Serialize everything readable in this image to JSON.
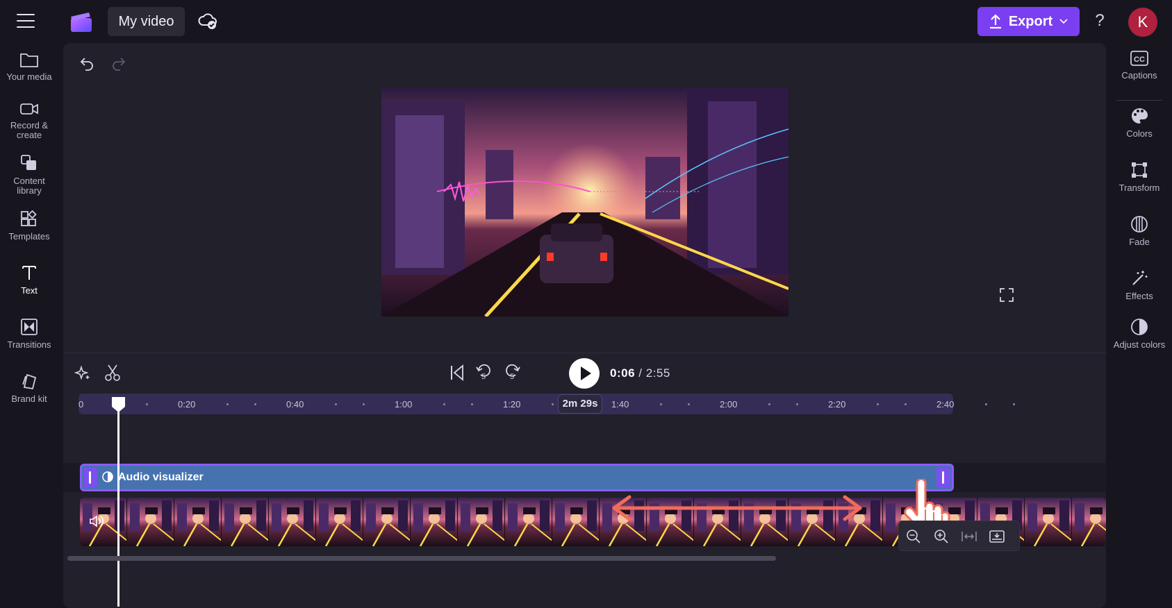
{
  "header": {
    "project_title": "My video",
    "export_label": "Export",
    "help_label": "?",
    "avatar_initial": "K"
  },
  "left_nav": {
    "items": [
      {
        "label": "Your media",
        "icon": "folder-icon"
      },
      {
        "label": "Record & create",
        "icon": "camera-icon"
      },
      {
        "label": "Content library",
        "icon": "library-icon"
      },
      {
        "label": "Templates",
        "icon": "templates-icon"
      },
      {
        "label": "Text",
        "icon": "text-icon"
      },
      {
        "label": "Transitions",
        "icon": "transitions-icon"
      },
      {
        "label": "Brand kit",
        "icon": "brand-kit-icon"
      }
    ],
    "active": "Text"
  },
  "right_panel": {
    "items": [
      {
        "label": "Captions",
        "icon": "captions-icon"
      },
      {
        "label": "Colors",
        "icon": "palette-icon"
      },
      {
        "label": "Transform",
        "icon": "transform-icon"
      },
      {
        "label": "Fade",
        "icon": "fade-icon"
      },
      {
        "label": "Effects",
        "icon": "magic-wand-icon"
      },
      {
        "label": "Adjust colors",
        "icon": "adjust-colors-icon"
      }
    ]
  },
  "playback": {
    "current_time": "0:06",
    "separator": "/",
    "total_time": "2:55",
    "rewind_label": "5",
    "forward_label": "5"
  },
  "timeline": {
    "ruler_ticks": [
      "0",
      "0:20",
      "0:40",
      "1:00",
      "1:20",
      "1:40",
      "2:00",
      "2:20",
      "2:40"
    ],
    "duration_badge": "2m 29s",
    "audio_clip_label": "Audio visualizer"
  },
  "colors": {
    "accent": "#7b3ff2",
    "avatar": "#b0213f",
    "audio_clip": "#4673b0",
    "clip_border": "#8a5cf6",
    "annotation_arrow": "#f26b5b"
  }
}
